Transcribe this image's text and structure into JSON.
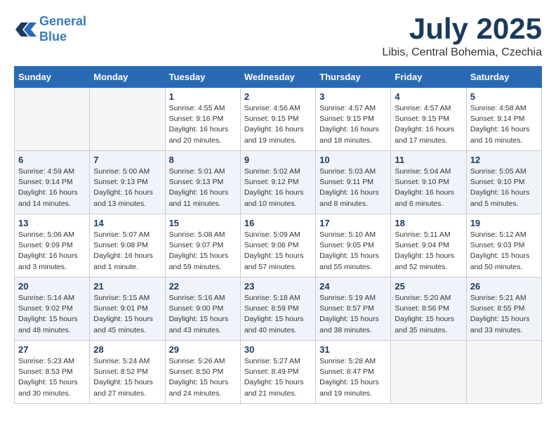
{
  "header": {
    "logo_line1": "General",
    "logo_line2": "Blue",
    "month": "July 2025",
    "location": "Libis, Central Bohemia, Czechia"
  },
  "columns": [
    "Sunday",
    "Monday",
    "Tuesday",
    "Wednesday",
    "Thursday",
    "Friday",
    "Saturday"
  ],
  "weeks": [
    [
      {
        "day": "",
        "empty": true
      },
      {
        "day": "",
        "empty": true
      },
      {
        "day": "1",
        "sunrise": "Sunrise: 4:55 AM",
        "sunset": "Sunset: 9:16 PM",
        "daylight": "Daylight: 16 hours and 20 minutes."
      },
      {
        "day": "2",
        "sunrise": "Sunrise: 4:56 AM",
        "sunset": "Sunset: 9:15 PM",
        "daylight": "Daylight: 16 hours and 19 minutes."
      },
      {
        "day": "3",
        "sunrise": "Sunrise: 4:57 AM",
        "sunset": "Sunset: 9:15 PM",
        "daylight": "Daylight: 16 hours and 18 minutes."
      },
      {
        "day": "4",
        "sunrise": "Sunrise: 4:57 AM",
        "sunset": "Sunset: 9:15 PM",
        "daylight": "Daylight: 16 hours and 17 minutes."
      },
      {
        "day": "5",
        "sunrise": "Sunrise: 4:58 AM",
        "sunset": "Sunset: 9:14 PM",
        "daylight": "Daylight: 16 hours and 16 minutes."
      }
    ],
    [
      {
        "day": "6",
        "sunrise": "Sunrise: 4:59 AM",
        "sunset": "Sunset: 9:14 PM",
        "daylight": "Daylight: 16 hours and 14 minutes."
      },
      {
        "day": "7",
        "sunrise": "Sunrise: 5:00 AM",
        "sunset": "Sunset: 9:13 PM",
        "daylight": "Daylight: 16 hours and 13 minutes."
      },
      {
        "day": "8",
        "sunrise": "Sunrise: 5:01 AM",
        "sunset": "Sunset: 9:13 PM",
        "daylight": "Daylight: 16 hours and 11 minutes."
      },
      {
        "day": "9",
        "sunrise": "Sunrise: 5:02 AM",
        "sunset": "Sunset: 9:12 PM",
        "daylight": "Daylight: 16 hours and 10 minutes."
      },
      {
        "day": "10",
        "sunrise": "Sunrise: 5:03 AM",
        "sunset": "Sunset: 9:11 PM",
        "daylight": "Daylight: 16 hours and 8 minutes."
      },
      {
        "day": "11",
        "sunrise": "Sunrise: 5:04 AM",
        "sunset": "Sunset: 9:10 PM",
        "daylight": "Daylight: 16 hours and 6 minutes."
      },
      {
        "day": "12",
        "sunrise": "Sunrise: 5:05 AM",
        "sunset": "Sunset: 9:10 PM",
        "daylight": "Daylight: 16 hours and 5 minutes."
      }
    ],
    [
      {
        "day": "13",
        "sunrise": "Sunrise: 5:06 AM",
        "sunset": "Sunset: 9:09 PM",
        "daylight": "Daylight: 16 hours and 3 minutes."
      },
      {
        "day": "14",
        "sunrise": "Sunrise: 5:07 AM",
        "sunset": "Sunset: 9:08 PM",
        "daylight": "Daylight: 16 hours and 1 minute."
      },
      {
        "day": "15",
        "sunrise": "Sunrise: 5:08 AM",
        "sunset": "Sunset: 9:07 PM",
        "daylight": "Daylight: 15 hours and 59 minutes."
      },
      {
        "day": "16",
        "sunrise": "Sunrise: 5:09 AM",
        "sunset": "Sunset: 9:06 PM",
        "daylight": "Daylight: 15 hours and 57 minutes."
      },
      {
        "day": "17",
        "sunrise": "Sunrise: 5:10 AM",
        "sunset": "Sunset: 9:05 PM",
        "daylight": "Daylight: 15 hours and 55 minutes."
      },
      {
        "day": "18",
        "sunrise": "Sunrise: 5:11 AM",
        "sunset": "Sunset: 9:04 PM",
        "daylight": "Daylight: 15 hours and 52 minutes."
      },
      {
        "day": "19",
        "sunrise": "Sunrise: 5:12 AM",
        "sunset": "Sunset: 9:03 PM",
        "daylight": "Daylight: 15 hours and 50 minutes."
      }
    ],
    [
      {
        "day": "20",
        "sunrise": "Sunrise: 5:14 AM",
        "sunset": "Sunset: 9:02 PM",
        "daylight": "Daylight: 15 hours and 48 minutes."
      },
      {
        "day": "21",
        "sunrise": "Sunrise: 5:15 AM",
        "sunset": "Sunset: 9:01 PM",
        "daylight": "Daylight: 15 hours and 45 minutes."
      },
      {
        "day": "22",
        "sunrise": "Sunrise: 5:16 AM",
        "sunset": "Sunset: 9:00 PM",
        "daylight": "Daylight: 15 hours and 43 minutes."
      },
      {
        "day": "23",
        "sunrise": "Sunrise: 5:18 AM",
        "sunset": "Sunset: 8:59 PM",
        "daylight": "Daylight: 15 hours and 40 minutes."
      },
      {
        "day": "24",
        "sunrise": "Sunrise: 5:19 AM",
        "sunset": "Sunset: 8:57 PM",
        "daylight": "Daylight: 15 hours and 38 minutes."
      },
      {
        "day": "25",
        "sunrise": "Sunrise: 5:20 AM",
        "sunset": "Sunset: 8:56 PM",
        "daylight": "Daylight: 15 hours and 35 minutes."
      },
      {
        "day": "26",
        "sunrise": "Sunrise: 5:21 AM",
        "sunset": "Sunset: 8:55 PM",
        "daylight": "Daylight: 15 hours and 33 minutes."
      }
    ],
    [
      {
        "day": "27",
        "sunrise": "Sunrise: 5:23 AM",
        "sunset": "Sunset: 8:53 PM",
        "daylight": "Daylight: 15 hours and 30 minutes."
      },
      {
        "day": "28",
        "sunrise": "Sunrise: 5:24 AM",
        "sunset": "Sunset: 8:52 PM",
        "daylight": "Daylight: 15 hours and 27 minutes."
      },
      {
        "day": "29",
        "sunrise": "Sunrise: 5:26 AM",
        "sunset": "Sunset: 8:50 PM",
        "daylight": "Daylight: 15 hours and 24 minutes."
      },
      {
        "day": "30",
        "sunrise": "Sunrise: 5:27 AM",
        "sunset": "Sunset: 8:49 PM",
        "daylight": "Daylight: 15 hours and 21 minutes."
      },
      {
        "day": "31",
        "sunrise": "Sunrise: 5:28 AM",
        "sunset": "Sunset: 8:47 PM",
        "daylight": "Daylight: 15 hours and 19 minutes."
      },
      {
        "day": "",
        "empty": true
      },
      {
        "day": "",
        "empty": true
      }
    ]
  ]
}
